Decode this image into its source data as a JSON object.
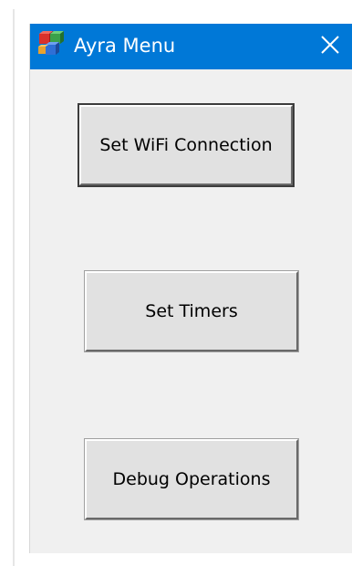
{
  "window": {
    "title": "Ayra Menu",
    "titlebar_color": "#0078d7",
    "app_icon": "app-cubes-icon",
    "close_icon": "close-icon"
  },
  "buttons": {
    "wifi_label": "Set WiFi Connection",
    "timers_label": "Set Timers",
    "debug_label": "Debug Operations"
  }
}
